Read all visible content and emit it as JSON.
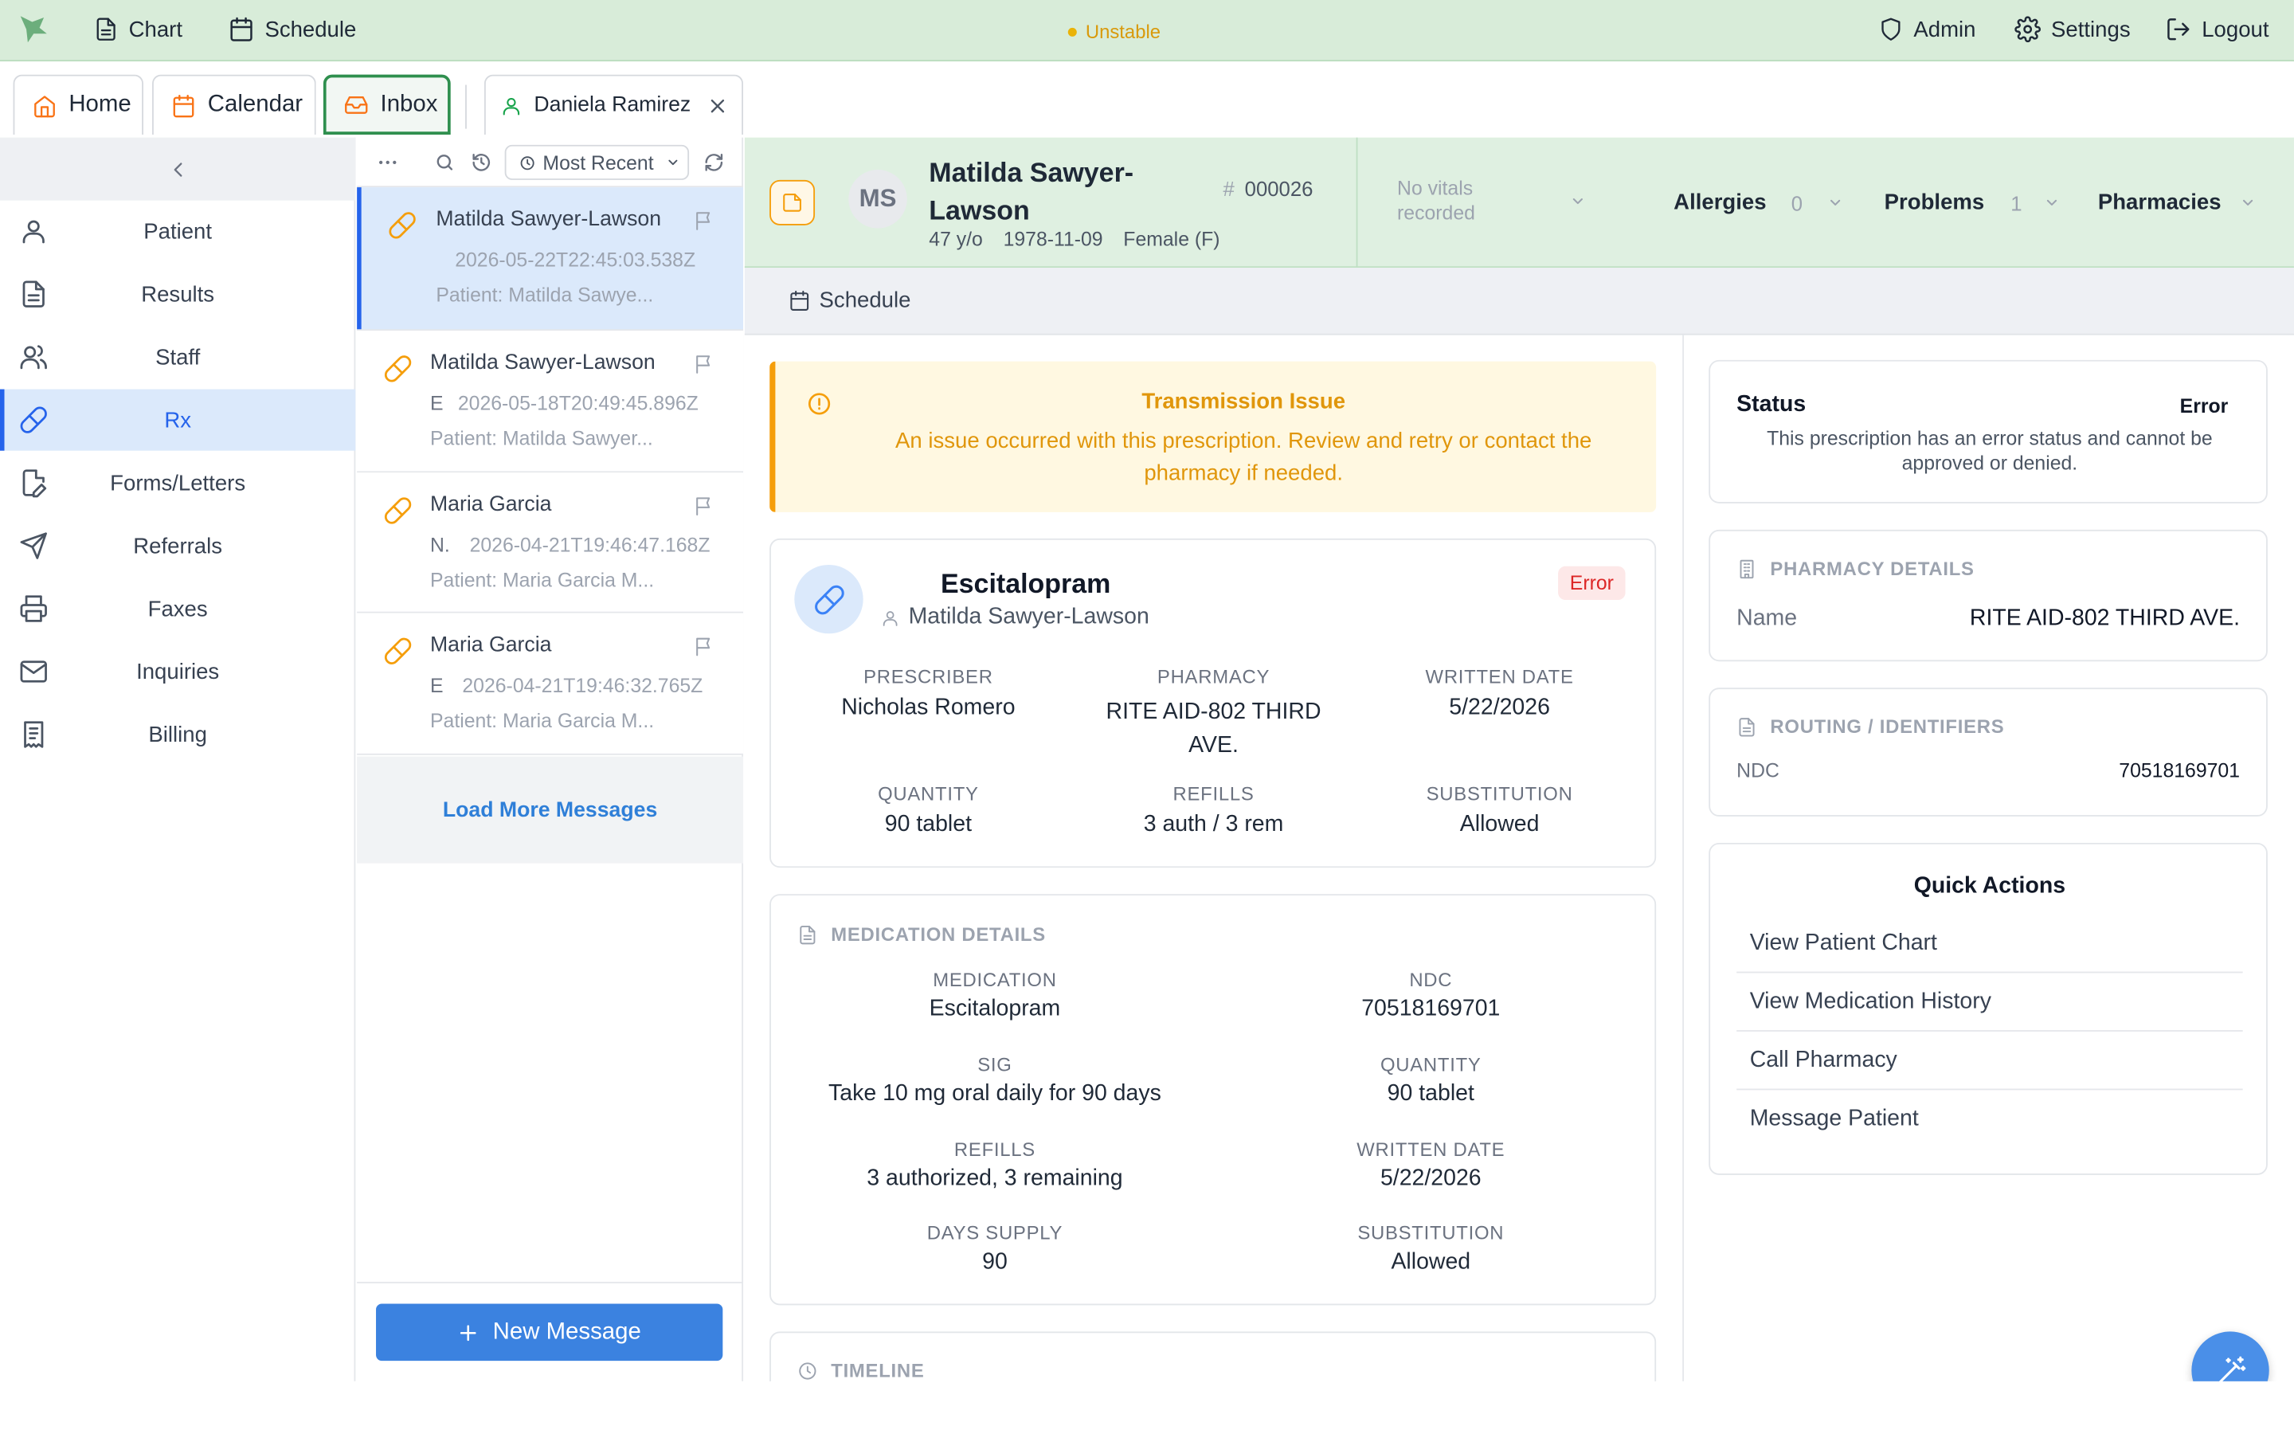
{
  "topbar": {
    "chart": "Chart",
    "schedule": "Schedule",
    "status": "Unstable",
    "admin": "Admin",
    "settings": "Settings",
    "logout": "Logout"
  },
  "tabs": {
    "home": "Home",
    "calendar": "Calendar",
    "inbox": "Inbox",
    "patient_tab": "Daniela Ramirez"
  },
  "sidebar": {
    "items": [
      "Patient",
      "Results",
      "Staff",
      "Rx",
      "Forms/Letters",
      "Referrals",
      "Faxes",
      "Inquiries",
      "Billing"
    ],
    "active": "Rx"
  },
  "message_list": {
    "sort": "Most Recent",
    "messages": [
      {
        "name": "Matilda Sawyer-Lawson",
        "prefix": "",
        "date": "2026-05-22T22:45:03.538Z",
        "patient": "Patient: Matilda Sawye..."
      },
      {
        "name": "Matilda Sawyer-Lawson",
        "prefix": "E",
        "date": "2026-05-18T20:49:45.896Z",
        "patient": "Patient: Matilda Sawyer..."
      },
      {
        "name": "Maria Garcia",
        "prefix": "N.",
        "date": "2026-04-21T19:46:47.168Z",
        "patient": "Patient: Maria Garcia M..."
      },
      {
        "name": "Maria Garcia",
        "prefix": "E",
        "date": "2026-04-21T19:46:32.765Z",
        "patient": "Patient: Maria Garcia M..."
      }
    ],
    "load_more": "Load More Messages",
    "new_message": "New Message"
  },
  "patient": {
    "initials": "MS",
    "name_line1": "Matilda Sawyer-",
    "name_line2": "Lawson",
    "id": "000026",
    "age": "47 y/o",
    "dob": "1978-11-09",
    "sex": "Female (F)",
    "vitals_line1": "No vitals",
    "vitals_line2": "recorded",
    "allergies_label": "Allergies",
    "allergies_count": "0",
    "problems_label": "Problems",
    "problems_count": "1",
    "pharmacies_label": "Pharmacies"
  },
  "schedule_label": "Schedule",
  "alert": {
    "title": "Transmission Issue",
    "line1": "An issue occurred with this prescription. Review and retry or contact the",
    "line2": "pharmacy if needed."
  },
  "rx": {
    "drug": "Escitalopram",
    "patient": "Matilda Sawyer-Lawson",
    "status": "Error",
    "prescriber_label": "PRESCRIBER",
    "prescriber": "Nicholas Romero",
    "pharmacy_label": "PHARMACY",
    "pharmacy_line1": "RITE AID-802 THIRD",
    "pharmacy_line2": "AVE.",
    "written_label": "WRITTEN DATE",
    "written": "5/22/2026",
    "quantity_label": "QUANTITY",
    "quantity": "90 tablet",
    "refills_label": "REFILLS",
    "refills": "3 auth / 3 rem",
    "substitution_label": "SUBSTITUTION",
    "substitution": "Allowed"
  },
  "med_details": {
    "title": "MEDICATION DETAILS",
    "medication_label": "MEDICATION",
    "medication": "Escitalopram",
    "ndc_label": "NDC",
    "ndc": "70518169701",
    "sig_label": "SIG",
    "sig": "Take 10 mg oral daily for 90 days",
    "quantity_label": "QUANTITY",
    "quantity": "90 tablet",
    "refills_label": "REFILLS",
    "refills": "3 authorized, 3 remaining",
    "written_label": "WRITTEN DATE",
    "written": "5/22/2026",
    "days_label": "DAYS SUPPLY",
    "days": "90",
    "substitution_label": "SUBSTITUTION",
    "substitution": "Allowed"
  },
  "timeline_title": "TIMELINE",
  "status_card": {
    "title": "Status",
    "value": "Error",
    "line1": "This prescription has an error status and cannot be",
    "line2": "approved or denied."
  },
  "pharmacy_card": {
    "title": "PHARMACY DETAILS",
    "name_label": "Name",
    "name": "RITE AID-802 THIRD AVE."
  },
  "routing_card": {
    "title": "ROUTING / IDENTIFIERS",
    "ndc_label": "NDC",
    "ndc": "70518169701"
  },
  "quick_actions": {
    "title": "Quick Actions",
    "items": [
      "View Patient Chart",
      "View Medication History",
      "Call Pharmacy",
      "Message Patient"
    ]
  },
  "colors": {
    "topbar": "#d8ecd9",
    "accent": "#2563eb",
    "warning": "#f59e0b",
    "error": "#dc2626"
  }
}
